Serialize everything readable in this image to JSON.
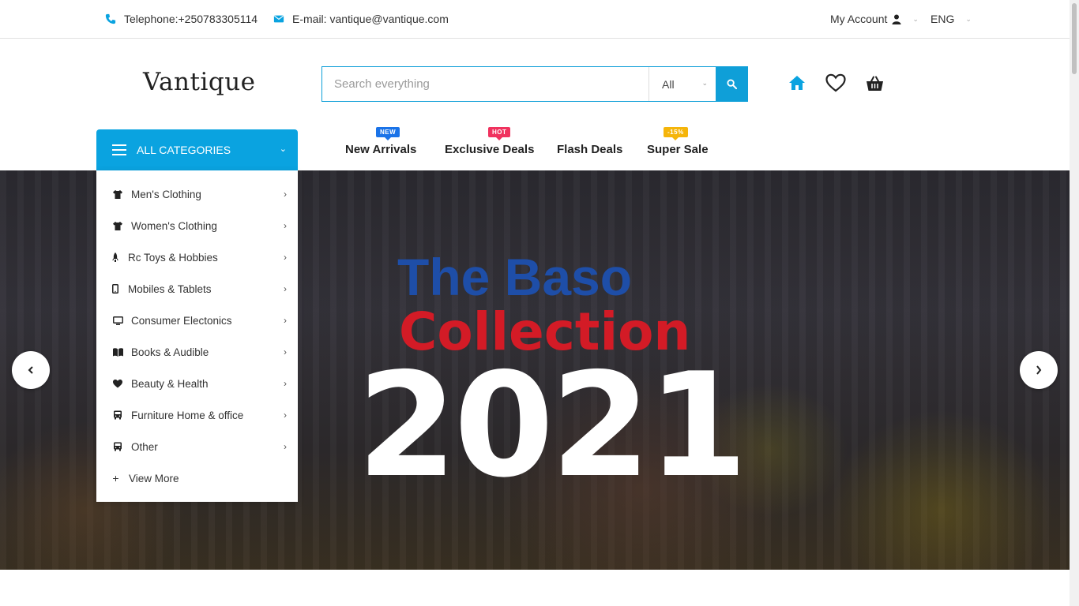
{
  "topbar": {
    "phone": "Telephone:+250783305114",
    "email": "E-mail: vantique@vantique.com",
    "account": "My Account",
    "language": "ENG"
  },
  "header": {
    "logo": "Vantique",
    "search_placeholder": "Search everything",
    "search_scope": "All"
  },
  "nav": {
    "all_categories": "ALL CATEGORIES",
    "links": [
      {
        "label": "New Arrivals",
        "badge": "NEW",
        "badge_color": "#1a73e8"
      },
      {
        "label": "Exclusive Deals",
        "badge": "HOT",
        "badge_color": "#f0325e"
      },
      {
        "label": "Flash Deals",
        "badge": "",
        "badge_color": ""
      },
      {
        "label": "Super Sale",
        "badge": "-15%",
        "badge_color": "#f5b50a"
      }
    ]
  },
  "categories": [
    {
      "label": "Men's Clothing",
      "icon": "tshirt-icon"
    },
    {
      "label": "Women's Clothing",
      "icon": "tshirt-icon"
    },
    {
      "label": "Rc Toys & Hobbies",
      "icon": "rocket-icon"
    },
    {
      "label": "Mobiles & Tablets",
      "icon": "mobile-icon"
    },
    {
      "label": "Consumer Electonics",
      "icon": "monitor-icon"
    },
    {
      "label": "Books & Audible",
      "icon": "book-icon"
    },
    {
      "label": "Beauty & Health",
      "icon": "heart-icon"
    },
    {
      "label": "Furniture Home & office",
      "icon": "bus-icon"
    },
    {
      "label": "Other",
      "icon": "bus-icon"
    },
    {
      "label": "View More",
      "icon": "plus-icon"
    }
  ],
  "hero": {
    "line1": "The Baso",
    "line2": "Collection",
    "year": "2021"
  },
  "colors": {
    "accent": "#0aa3e0",
    "hero_blue": "#1e4ea8",
    "hero_red": "#d31b26"
  }
}
